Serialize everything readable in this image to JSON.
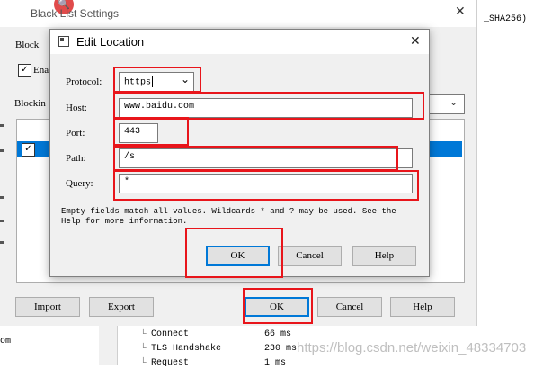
{
  "background_window": {
    "title": "Black List Settings",
    "right_text": "_SHA256)",
    "block_label": "Block",
    "enable_label": "Ena",
    "blocking_label": "Blockin",
    "import_button": "Import",
    "export_button": "Export",
    "ok_button": "OK",
    "cancel_button": "Cancel",
    "help_button": "Help",
    "left_edge_text": "om",
    "timing_rows": [
      {
        "label": "Connect",
        "value": "66 ms"
      },
      {
        "label": "TLS Handshake",
        "value": "230 ms"
      },
      {
        "label": "Request",
        "value": "1 ms"
      }
    ],
    "watermark": "https://blog.csdn.net/weixin_48334703"
  },
  "dialog": {
    "title": "Edit Location",
    "protocol_label": "Protocol:",
    "protocol_value": "https",
    "host_label": "Host:",
    "host_value": "www.baidu.com",
    "port_label": "Port:",
    "port_value": "443",
    "path_label": "Path:",
    "path_value": "/s",
    "query_label": "Query:",
    "query_value": "*",
    "help_text": "Empty fields match all values. Wildcards * and ? may be used. See the Help for more information.",
    "ok_button": "OK",
    "cancel_button": "Cancel",
    "help_button": "Help"
  },
  "colors": {
    "annotation_red": "#e8151b",
    "dialog_bg": "#f0f0f0",
    "selection_blue": "#0078d7"
  }
}
